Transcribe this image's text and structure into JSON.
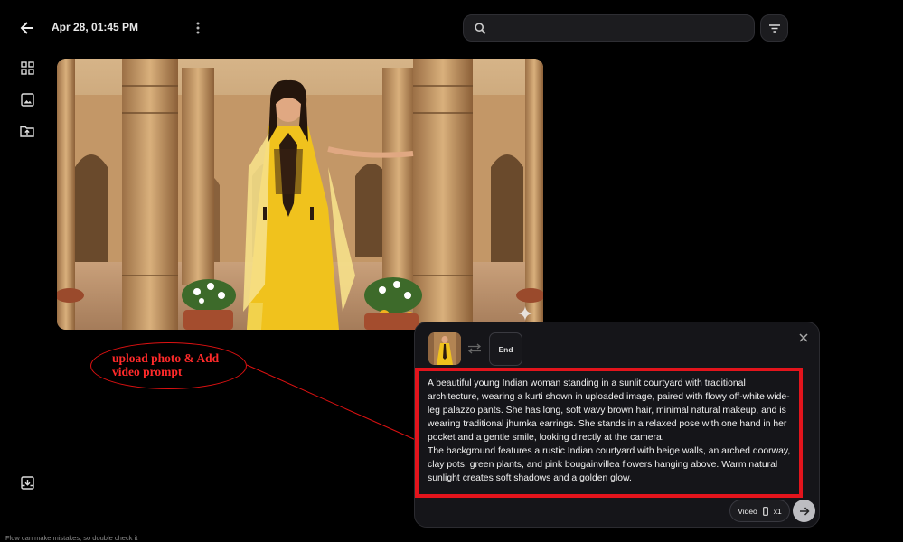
{
  "header": {
    "date": "Apr 28, 01:45 PM",
    "search_placeholder": ""
  },
  "icons": {
    "back": "arrow-left-icon",
    "more": "more-vert-icon",
    "search": "search-icon",
    "filter": "filter-icon",
    "sidebar": [
      "grid-view-icon",
      "image-icon",
      "upload-folder-icon",
      "download-box-icon"
    ]
  },
  "annotation": {
    "text": "upload photo & Add video prompt",
    "color": "#ff2a2a"
  },
  "composer": {
    "end_label": "End",
    "prompt_paragraphs": [
      "A beautiful young Indian woman standing in a sunlit courtyard with traditional architecture, wearing a kurti shown in uploaded image, paired with flowy off-white wide-leg palazzo pants. She has long, soft wavy brown hair, minimal natural makeup, and is wearing traditional jhumka earrings. She stands in a relaxed pose with one hand in her pocket and a gentle smile, looking directly at the camera.",
      "The background features a rustic Indian courtyard with beige walls, an arched doorway, clay pots, green plants, and pink bougainvillea flowers hanging above. Warm natural sunlight creates soft shadows and a golden glow."
    ],
    "mode_label": "Video",
    "count_label": "x1",
    "highlight_color": "#e3141c"
  },
  "footer": {
    "note": "Flow can make mistakes, so double check it"
  }
}
